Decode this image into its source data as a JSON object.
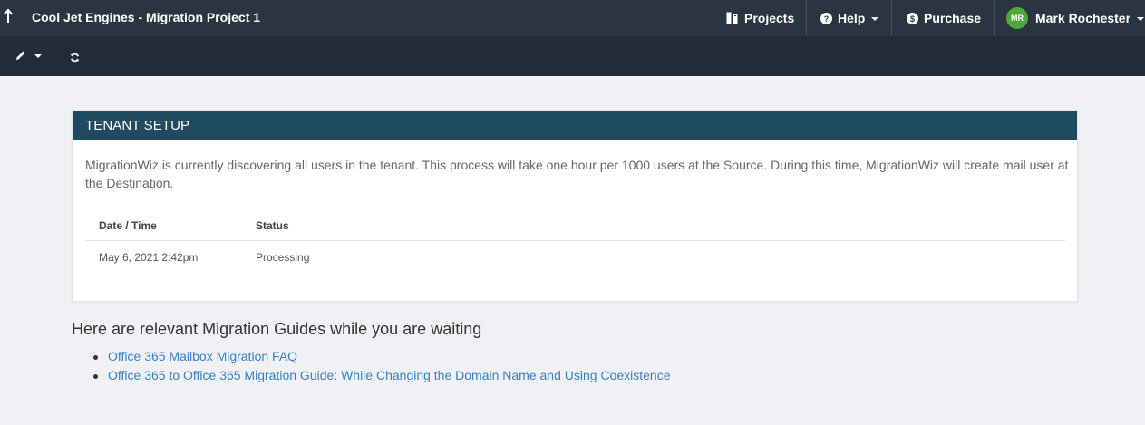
{
  "header": {
    "title": "Cool Jet Engines - Migration Project 1",
    "nav": {
      "projects": "Projects",
      "help": "Help",
      "purchase": "Purchase",
      "user_initials": "MR",
      "user_name": "Mark Rochester"
    }
  },
  "toolbar": {
    "icons": [
      "pencil-icon",
      "chevron-down-icon",
      "refresh-icon"
    ]
  },
  "panel": {
    "title": "TENANT SETUP",
    "description": "MigrationWiz is currently discovering all users in the tenant. This process will take one hour per 1000 users at the Source. During this time, MigrationWiz will create mail user at the Destination.",
    "table": {
      "columns": [
        "Date / Time",
        "Status"
      ],
      "rows": [
        [
          "May 6, 2021 2:42pm",
          "Processing"
        ]
      ]
    }
  },
  "guides": {
    "title": "Here are relevant Migration Guides while you are waiting",
    "links": [
      "Office 365 Mailbox Migration FAQ",
      "Office 365 to Office 365 Migration Guide: While Changing the Domain Name and Using Coexistence"
    ]
  },
  "colors": {
    "topbar": "#2b3541",
    "toolbar": "#222b37",
    "panel_header": "#1f4a5f",
    "link": "#3a7fc1",
    "avatar": "#4fa83d"
  }
}
